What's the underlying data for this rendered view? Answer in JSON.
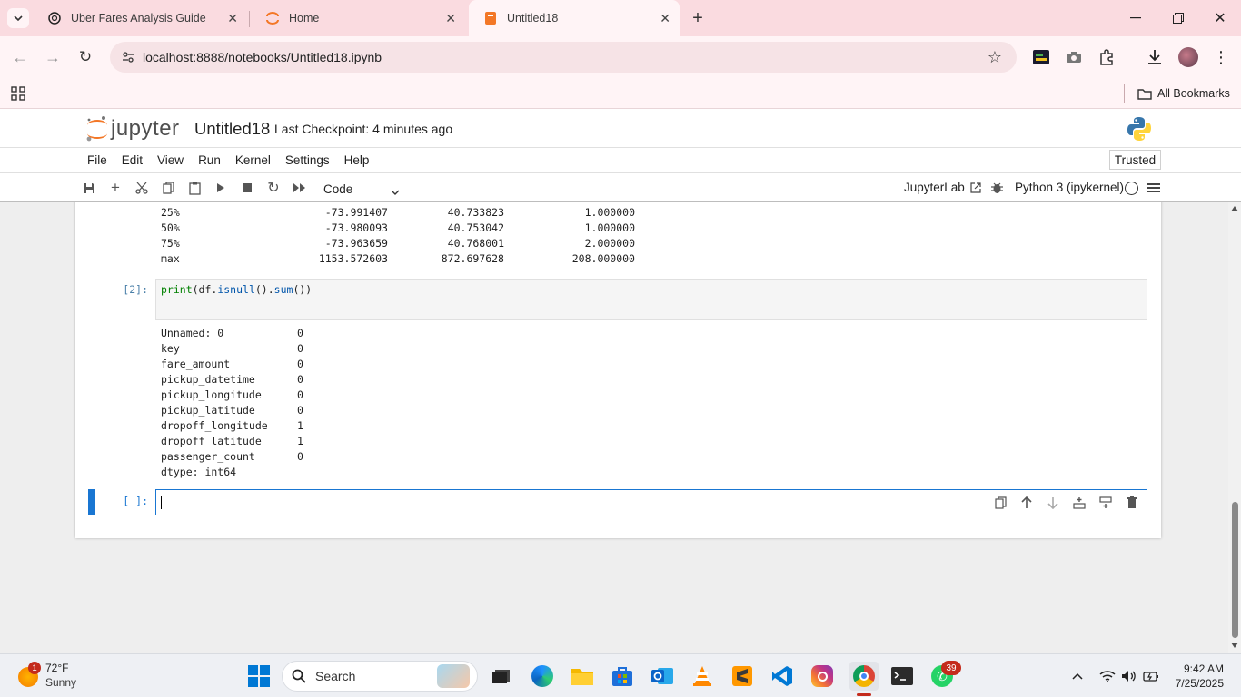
{
  "browser": {
    "tabs": [
      {
        "title": "Uber Fares Analysis Guide"
      },
      {
        "title": "Home"
      },
      {
        "title": "Untitled18"
      }
    ],
    "url": "localhost:8888/notebooks/Untitled18.ipynb",
    "bookmarks_label": "All Bookmarks"
  },
  "jupyter": {
    "logo_text": "jupyter",
    "notebook_name": "Untitled18",
    "checkpoint": "Last Checkpoint: 4 minutes ago",
    "trusted": "Trusted",
    "menus": [
      "File",
      "Edit",
      "View",
      "Run",
      "Kernel",
      "Settings",
      "Help"
    ],
    "cell_type": "Code",
    "jupyterlab_link": "JupyterLab",
    "kernel": "Python 3 (ipykernel)"
  },
  "notebook": {
    "describe_rows": [
      {
        "label": "25%",
        "c1": "-73.991407",
        "c2": "40.733823",
        "c3": "1.000000"
      },
      {
        "label": "50%",
        "c1": "-73.980093",
        "c2": "40.753042",
        "c3": "1.000000"
      },
      {
        "label": "75%",
        "c1": "-73.963659",
        "c2": "40.768001",
        "c3": "2.000000"
      },
      {
        "label": "max",
        "c1": "1153.572603",
        "c2": "872.697628",
        "c3": "208.000000"
      }
    ],
    "cell2_prompt": "[2]:",
    "cell2_code": {
      "p1": "print",
      "p2": "(df.",
      "p3": "isnull",
      "p4": "().",
      "p5": "sum",
      "p6": "())"
    },
    "cell2_output": [
      {
        "name": "Unnamed: 0",
        "value": "0"
      },
      {
        "name": "key",
        "value": "0"
      },
      {
        "name": "fare_amount",
        "value": "0"
      },
      {
        "name": "pickup_datetime",
        "value": "0"
      },
      {
        "name": "pickup_longitude",
        "value": "0"
      },
      {
        "name": "pickup_latitude",
        "value": "0"
      },
      {
        "name": "dropoff_longitude",
        "value": "1"
      },
      {
        "name": "dropoff_latitude",
        "value": "1"
      },
      {
        "name": "passenger_count",
        "value": "0"
      }
    ],
    "dtype_line": "dtype: int64",
    "cell3_prompt": "[ ]:"
  },
  "taskbar": {
    "weather_temp": "72°F",
    "weather_desc": "Sunny",
    "weather_badge": "1",
    "search_label": "Search",
    "whatsapp_badge": "39",
    "time": "9:42 AM",
    "date": "7/25/2025"
  }
}
